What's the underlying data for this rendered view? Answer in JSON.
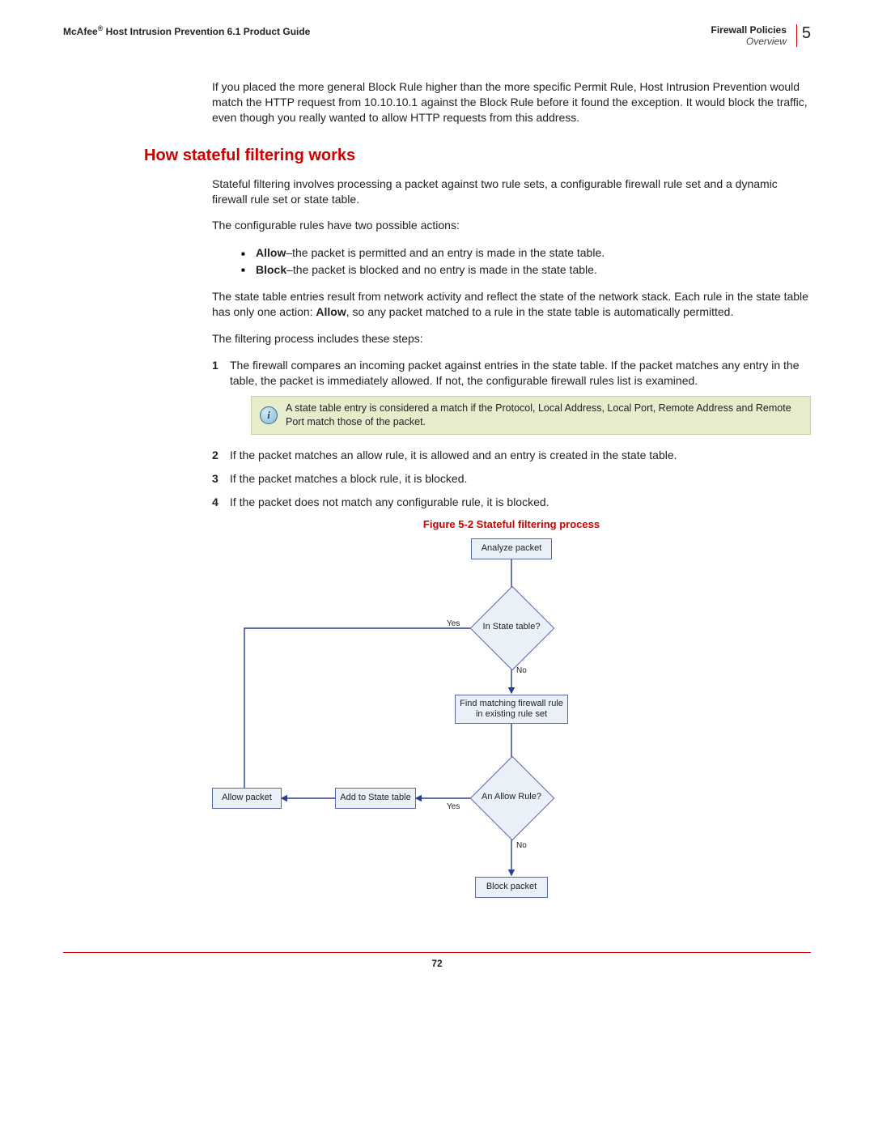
{
  "header": {
    "brand": "McAfee",
    "reg": "®",
    "product": " Host Intrusion Prevention 6.1 Product Guide",
    "policies": "Firewall Policies",
    "overview": "Overview",
    "chapter": "5"
  },
  "intro": "If you placed the more general Block Rule higher than the more specific Permit Rule, Host Intrusion Prevention would match the HTTP request from 10.10.10.1 against the Block Rule before it found the exception. It would block the traffic, even though you really wanted to allow HTTP requests from this address.",
  "section_title": "How stateful filtering works",
  "p1": "Stateful filtering involves processing a packet against two rule sets, a configurable firewall rule set and a dynamic firewall rule set or state table.",
  "p2": "The configurable rules have two possible actions:",
  "bullets": {
    "allow_b": "Allow",
    "allow_t": "–the packet is permitted and an entry is made in the state table.",
    "block_b": "Block",
    "block_t": "–the packet is blocked and no entry is made in the state table."
  },
  "p3a": "The state table entries result from network activity and reflect the state of the network stack. Each rule in the state table has only one action: ",
  "p3_bold": "Allow",
  "p3b": ", so any packet matched to a rule in the state table is automatically permitted.",
  "p4": "The filtering process includes these steps:",
  "steps": {
    "s1": "The firewall compares an incoming packet against entries in the state table. If the packet matches any entry in the table, the packet is immediately allowed. If not, the configurable firewall rules list is examined.",
    "note": "A state table entry is considered a match if the Protocol, Local Address, Local Port, Remote Address and Remote Port match those of the packet.",
    "s2": "If the packet matches an allow rule, it is allowed and an entry is created in the state table.",
    "s3": "If the packet matches a block rule, it is blocked.",
    "s4": "If the packet does not match any configurable rule, it is blocked."
  },
  "figure_caption": "Figure 5-2  Stateful filtering process",
  "flow": {
    "analyze": "Analyze packet",
    "in_state": "In State table?",
    "find_rule": "Find matching firewall rule in existing rule set",
    "allow_rule": "An Allow Rule?",
    "add_state": "Add to State table",
    "allow_pkt": "Allow packet",
    "block_pkt": "Block packet",
    "yes": "Yes",
    "no": "No"
  },
  "page_number": "72"
}
